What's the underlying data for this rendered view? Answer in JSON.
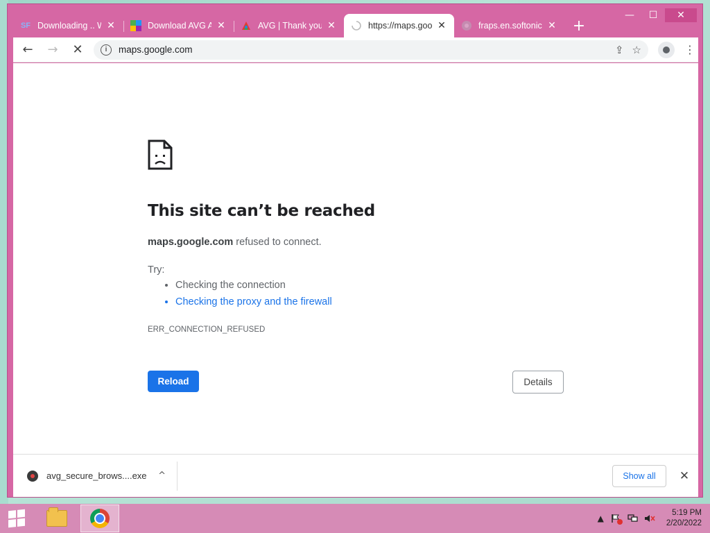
{
  "window": {
    "controls": {
      "minimize": "—",
      "maximize": "☐",
      "close": "✕"
    }
  },
  "tabs": [
    {
      "favicon": "SF",
      "title": "Downloading .. W",
      "active": false
    },
    {
      "favicon": "avg-download-icon",
      "title": "Download AVG A",
      "active": false
    },
    {
      "favicon": "avg-icon",
      "title": "AVG | Thank you f",
      "active": false
    },
    {
      "favicon": "loading-spinner-icon",
      "title": "https://maps.goog",
      "active": true
    },
    {
      "favicon": "globe-icon",
      "title": "fraps.en.softonic.",
      "active": false
    }
  ],
  "toolbar": {
    "url": "maps.google.com",
    "info_glyph": "i",
    "back": "←",
    "forward": "→",
    "reload": "✕",
    "new_tab": "+"
  },
  "error": {
    "title": "This site can’t be reached",
    "host": "maps.google.com",
    "message": " refused to connect.",
    "try_label": "Try:",
    "suggestions": [
      "Checking the connection",
      "Checking the proxy and the firewall"
    ],
    "code": "ERR_CONNECTION_REFUSED",
    "reload_label": "Reload",
    "details_label": "Details"
  },
  "downloads": {
    "file_name": "avg_secure_brows....exe",
    "show_all_label": "Show all",
    "close_glyph": "✕"
  },
  "taskbar": {
    "time": "5:19 PM",
    "date": "2/20/2022"
  },
  "colors": {
    "window_frame": "#d667a4",
    "link": "#1a73e8",
    "taskbar": "#d68bb6"
  }
}
